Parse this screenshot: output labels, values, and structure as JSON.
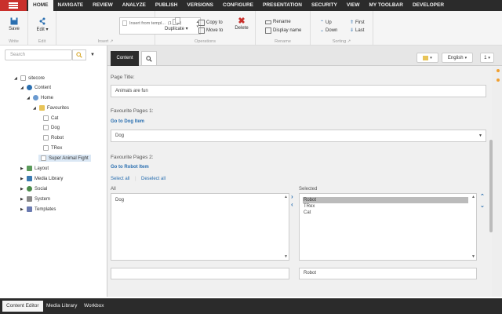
{
  "menu": {
    "tabs": [
      "HOME",
      "NAVIGATE",
      "REVIEW",
      "ANALYZE",
      "PUBLISH",
      "VERSIONS",
      "CONFIGURE",
      "PRESENTATION",
      "SECURITY",
      "VIEW",
      "MY TOOLBAR",
      "DEVELOPER"
    ],
    "active_tab": "HOME"
  },
  "ribbon": {
    "save_label": "Save",
    "write_group": "Write",
    "edit_label": "Edit",
    "edit_group": "Edit",
    "insert_placeholder": "Insert from templ...",
    "insert_count": "(1 of 1)",
    "insert_group": "Insert",
    "duplicate_label": "Duplicate",
    "copy_to_label": "Copy to",
    "move_to_label": "Move to",
    "delete_label": "Delete",
    "operations_group": "Operations",
    "rename_label": "Rename",
    "display_name_label": "Display name",
    "rename_group": "Rename",
    "up_label": "Up",
    "down_label": "Down",
    "first_label": "First",
    "last_label": "Last",
    "sorting_group": "Sorting",
    "group_arrow": "↗"
  },
  "sidebar": {
    "search_placeholder": "Search",
    "tree": [
      {
        "label": "sitecore",
        "icon": "sitecore-icon"
      },
      {
        "label": "Content",
        "icon": "content-icon"
      },
      {
        "label": "Home",
        "icon": "home-icon"
      },
      {
        "label": "Favourites",
        "icon": "folder-icon"
      },
      {
        "label": "Cat",
        "icon": "page-icon"
      },
      {
        "label": "Dog",
        "icon": "page-icon"
      },
      {
        "label": "Robot",
        "icon": "page-icon"
      },
      {
        "label": "TRex",
        "icon": "page-icon"
      },
      {
        "label": "Super Animal Fight",
        "icon": "page-icon",
        "selected": true
      },
      {
        "label": "Layout",
        "icon": "layout-icon"
      },
      {
        "label": "Media Library",
        "icon": "media-icon"
      },
      {
        "label": "Social",
        "icon": "social-icon"
      },
      {
        "label": "System",
        "icon": "system-icon"
      },
      {
        "label": "Templates",
        "icon": "templates-icon"
      }
    ]
  },
  "content_toolbar": {
    "content_tab": "Content",
    "language": "English"
  },
  "form": {
    "page_title_label": "Page Title:",
    "page_title_value": "Animals are fun",
    "fav1_label": "Favourite Pages 1:",
    "fav1_link": "Go to Dog Item",
    "fav1_value": "Dog",
    "fav2_label": "Favourite Pages 2:",
    "fav2_link": "Go to Robot Item",
    "select_all": "Select all",
    "deselect_all": "Deselect all",
    "all_label": "All",
    "selected_label": "Selected",
    "all_items": [
      "Dog"
    ],
    "selected_items": [
      "Robot",
      "TRex",
      "Cat"
    ],
    "selected_highlight": "Robot",
    "selected_detail": "Robot"
  },
  "bottom_tabs": [
    "Content Editor",
    "Media Library",
    "Workbox"
  ],
  "colors": {
    "accent": "#c9302c",
    "dark": "#2b2b2b",
    "link": "#2a6fb0"
  }
}
